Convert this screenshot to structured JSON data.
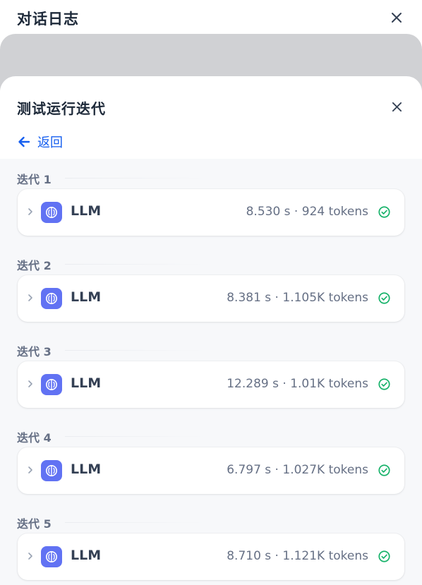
{
  "outer": {
    "title": "对话日志"
  },
  "panel": {
    "title": "测试运行迭代",
    "back_label": "返回"
  },
  "iterations": [
    {
      "label": "迭代 1",
      "node": "LLM",
      "time": "8.530 s",
      "tokens": "924 tokens"
    },
    {
      "label": "迭代 2",
      "node": "LLM",
      "time": "8.381 s",
      "tokens": "1.105K tokens"
    },
    {
      "label": "迭代 3",
      "node": "LLM",
      "time": "12.289 s",
      "tokens": "1.01K tokens"
    },
    {
      "label": "迭代 4",
      "node": "LLM",
      "time": "6.797 s",
      "tokens": "1.027K tokens"
    },
    {
      "label": "迭代 5",
      "node": "LLM",
      "time": "8.710 s",
      "tokens": "1.121K tokens"
    }
  ],
  "separator": " · ",
  "colors": {
    "accent": "#155eef",
    "node_icon_bg": "#6172f3",
    "success": "#17b26a"
  },
  "icons": {
    "close": "close-icon",
    "back": "arrow-left-icon",
    "expand": "chevron-right-icon",
    "node": "llm-brain-icon",
    "status": "check-circle-icon"
  }
}
